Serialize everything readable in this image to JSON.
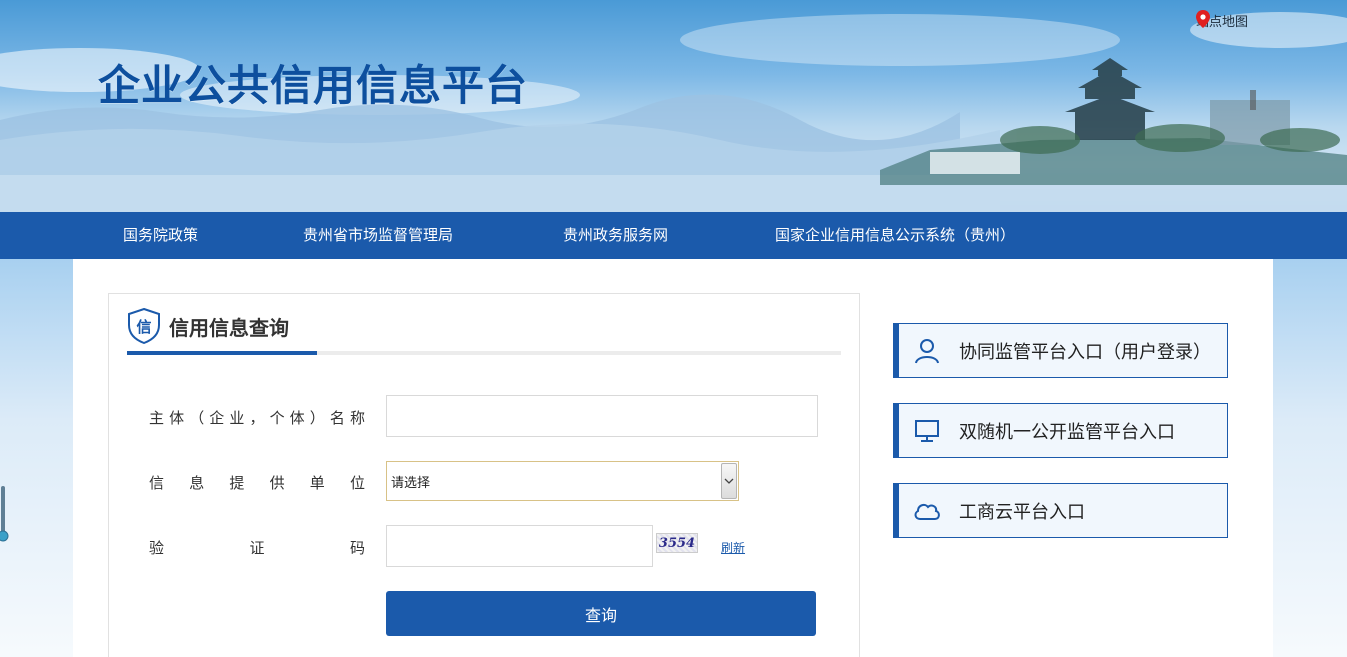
{
  "header": {
    "site_title": "企业公共信用信息平台",
    "sitemap_label": "站点地图",
    "sitemap_icon": "location-pin-icon"
  },
  "nav": {
    "items": [
      {
        "label": "国务院政策"
      },
      {
        "label": "贵州省市场监督管理局"
      },
      {
        "label": "贵州政务服务网"
      },
      {
        "label": "国家企业信用信息公示系统（贵州）"
      }
    ]
  },
  "query_panel": {
    "title": "信用信息查询",
    "title_icon_char": "信",
    "fields": {
      "name": {
        "label_chars": [
          "主",
          "体",
          "（",
          "企",
          "业",
          "，",
          "个",
          "体",
          "）",
          "名",
          "称"
        ],
        "value": "",
        "placeholder": ""
      },
      "provider": {
        "label_chars": [
          "信",
          "息",
          "提",
          "供",
          "单",
          "位"
        ],
        "selected": "请选择"
      },
      "captcha": {
        "label_chars": [
          "验",
          "证",
          "码"
        ],
        "value": "",
        "image_text": "3554",
        "refresh_label": "刷新"
      }
    },
    "submit_label": "查询"
  },
  "entries": [
    {
      "label": "协同监管平台入口（用户登录）",
      "icon": "user-icon"
    },
    {
      "label": "双随机一公开监管平台入口",
      "icon": "monitor-icon"
    },
    {
      "label": "工商云平台入口",
      "icon": "cloud-icon"
    }
  ],
  "colors": {
    "brand_blue": "#1b5aab",
    "title_blue": "#0d4f9e",
    "pin_red": "#e02020"
  }
}
